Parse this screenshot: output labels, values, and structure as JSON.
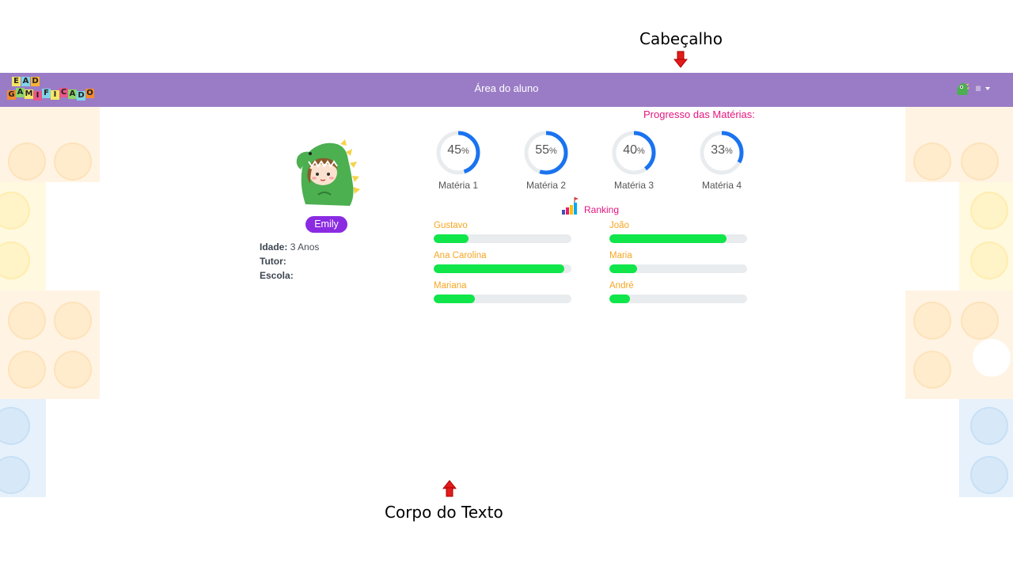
{
  "annotations": {
    "header": "Cabeçalho",
    "body": "Corpo do Texto"
  },
  "header": {
    "logo_tiles": [
      {
        "char": "E",
        "color": "#f5e663"
      },
      {
        "char": "A",
        "color": "#7fd3e8"
      },
      {
        "char": "D",
        "color": "#f9b233"
      },
      {
        "char": "G",
        "color": "#f28b30"
      },
      {
        "char": "A",
        "color": "#8bd36a"
      },
      {
        "char": "M",
        "color": "#f5e663"
      },
      {
        "char": "I",
        "color": "#e8578a"
      },
      {
        "char": "F",
        "color": "#7fd3e8"
      },
      {
        "char": "I",
        "color": "#f5e663"
      },
      {
        "char": "C",
        "color": "#e8578a"
      },
      {
        "char": "A",
        "color": "#8bd36a"
      },
      {
        "char": "D",
        "color": "#7fd3e8"
      },
      {
        "char": "O",
        "color": "#f28b30"
      }
    ],
    "title": "Área do aluno",
    "user_name": "lll"
  },
  "student": {
    "name": "Emily",
    "age_label": "Idade:",
    "age_value": "3 Anos",
    "tutor_label": "Tutor:",
    "tutor_value": "",
    "school_label": "Escola:",
    "school_value": ""
  },
  "progress": {
    "title": "Progresso das Matérias:",
    "subjects": [
      {
        "label": "Matéria 1",
        "value": 45
      },
      {
        "label": "Matéria 2",
        "value": 55
      },
      {
        "label": "Matéria 3",
        "value": 40
      },
      {
        "label": "Matéria 4",
        "value": 33
      }
    ],
    "percent_sign": "%"
  },
  "ranking": {
    "label": "Ranking",
    "entries": [
      {
        "name": "Gustavo",
        "value": 25
      },
      {
        "name": "João",
        "value": 85
      },
      {
        "name": "Ana Carolina",
        "value": 95
      },
      {
        "name": "Maria",
        "value": 20
      },
      {
        "name": "Mariana",
        "value": 30
      },
      {
        "name": "André",
        "value": 15
      }
    ]
  },
  "colors": {
    "navbar": "#9a7cc6",
    "accent_pink": "#e3167f",
    "badge_purple": "#8a2be2",
    "progress_blue": "#1a73f0",
    "rank_green": "#10e54a",
    "rank_name": "#f5a623"
  }
}
